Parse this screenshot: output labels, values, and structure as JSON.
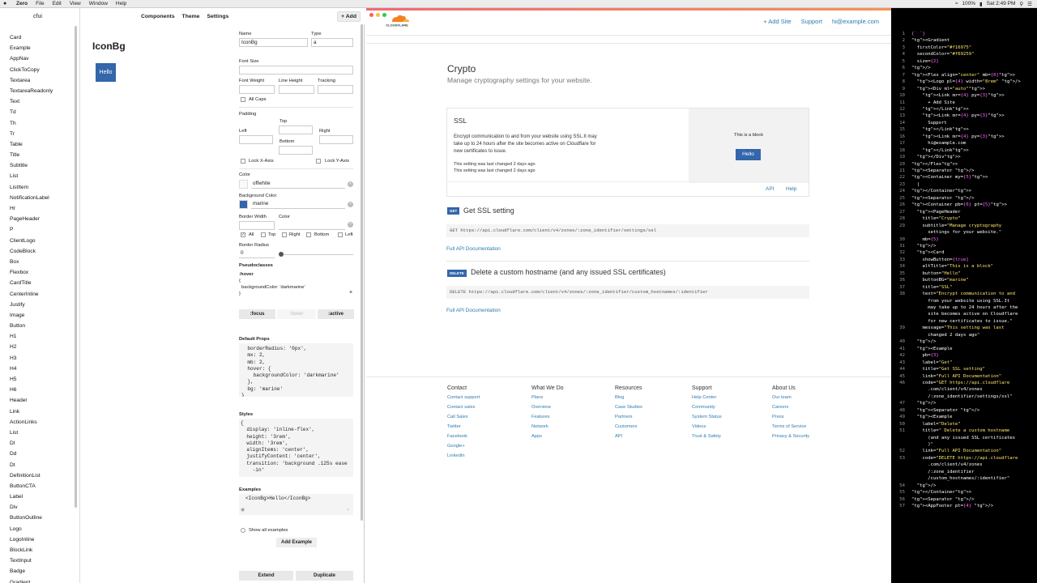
{
  "menubar": {
    "app_name": "Zero",
    "menus": [
      "File",
      "Edit",
      "View",
      "Window",
      "Help"
    ],
    "battery": "100%",
    "clock": "Sat 2:49 PM"
  },
  "sidebar": {
    "title": "cfui",
    "items": [
      "Card",
      "Example",
      "AppNav",
      "ClickToCopy",
      "Textarea",
      "TextareaReadonly",
      "Text",
      "Td",
      "Th",
      "Tr",
      "Table",
      "Title",
      "Subtitle",
      "List",
      "ListItem",
      "NotificationLabel",
      "Hr",
      "PageHeader",
      "P",
      "ClientLogo",
      "CodeBlock",
      "Box",
      "Flexbox",
      "CardTitle",
      "CenterInline",
      "Justify",
      "Image",
      "Button",
      "H1",
      "H2",
      "H3",
      "H4",
      "H5",
      "H6",
      "Header",
      "Link",
      "ActionLinks",
      "List",
      "Dl",
      "Dd",
      "Dt",
      "DefinitionList",
      "ButtonCTA",
      "Label",
      "Div",
      "ButtonOutline",
      "Logo",
      "LogoInline",
      "BlockLink",
      "TextInput",
      "Badge",
      "Gradient"
    ]
  },
  "topnav": {
    "components": "Components",
    "theme": "Theme",
    "settings": "Settings",
    "add": "+ Add"
  },
  "preview": {
    "component_name": "IconBg",
    "button_label": "Hello"
  },
  "props": {
    "name_label": "Name",
    "name_value": "IconBg",
    "type_label": "Type",
    "type_value": "a",
    "font_size_label": "Font Size",
    "font_weight_label": "Font Weight",
    "line_height_label": "Line Height",
    "tracking_label": "Tracking",
    "all_caps_label": "All Caps",
    "padding_label": "Padding",
    "top_label": "Top",
    "left_label": "Left",
    "right_label": "Right",
    "bottom_label": "Bottom",
    "lock_x_label": "Lock X-Axis",
    "lock_y_label": "Lock Y-Axis",
    "color_label": "Color",
    "color_value": "offwhite",
    "bg_color_label": "Background Color",
    "bg_color_value": "marine",
    "bg_swatch": "#3366aa",
    "border_width_label": "Border Width",
    "border_color_label": "Color",
    "border_sides": [
      "All",
      "Top",
      "Right",
      "Bottom",
      "Left"
    ],
    "border_radius_label": "Border Radius",
    "border_radius_value": "0",
    "pseudoclasses_label": "Pseudoclasses",
    "pseudo_selector": ":hover",
    "pseudo_open": "{",
    "pseudo_body": "  backgroundColor: 'darkmarine'",
    "pseudo_close": "}",
    "focus_btn": ":focus",
    "hover_btn": ":hover",
    "active_btn": ":active",
    "default_props_label": "Default Props",
    "default_props_code": "  borderRadius: '0px',\n  mx: 2,\n  mb: 2,\n  hover: {\n    backgroundColor: 'darkmarine'\n  },\n  bg: 'marine'\n}",
    "styles_label": "Styles",
    "styles_code": "{\n  display: 'inline-flex',\n  height: '3rem',\n  width: '3rem',\n  alignItems: 'center',\n  justifyContent: 'center',\n  transition: 'background .125s ease\n    -in'",
    "examples_label": "Examples",
    "example_code": "<IconBg>Hello</IconBg>",
    "show_all_examples": "Show all examples",
    "add_example": "Add Example",
    "extend": "Extend",
    "duplicate": "Duplicate"
  },
  "site": {
    "nav": [
      "+ Add Site",
      "Support",
      "hi@example.com"
    ],
    "page_title": "Crypto",
    "page_subtitle": "Manage cryptography settings for your website.",
    "card": {
      "title": "SSL",
      "text": "Encrypt communication to and from your website using SSL.It may take up to 24 hours after the site becomes active on Cloudflare for new certificates to issue.",
      "message_1": "This setting was last changed 2 days ago",
      "message_2": "This setting was last changed 2 days ago",
      "alt_title": "This is a block",
      "button": "Hello",
      "footer_links": [
        "API",
        "Help"
      ]
    },
    "example1": {
      "label": "GET",
      "title": "Get SSL setting",
      "code": "GET https://api.cloudflare.com/client/v4/zones/:zone_identifier/settings/ssl",
      "link": "Full API Documentation"
    },
    "example2": {
      "label": "DELETE",
      "title": "Delete a custom hostname (and any issued SSL certificates)",
      "code": "DELETE https://api.cloudflare.com/client/v4/zones/:zone_identifier/custom_hostnames/:identifier",
      "link": "Full API Documentation"
    },
    "footer": [
      {
        "heading": "Contact",
        "links": [
          "Contact support",
          "Contact sales",
          "Call Sales",
          "Twitter",
          "Facebook",
          "Google+",
          "LinkedIn"
        ]
      },
      {
        "heading": "What We Do",
        "links": [
          "Plans",
          "Overview",
          "Features",
          "Network",
          "Apps"
        ]
      },
      {
        "heading": "Resources",
        "links": [
          "Blog",
          "Case Studies",
          "Partners",
          "Customers",
          "API"
        ]
      },
      {
        "heading": "Support",
        "links": [
          "Help Center",
          "Community",
          "System Status",
          "Videos",
          "Trust & Safety"
        ]
      },
      {
        "heading": "About Us",
        "links": [
          "Our team",
          "Careers",
          "Press",
          "Terms of Service",
          "Privacy & Security"
        ]
      }
    ]
  },
  "editor": {
    "lines": [
      {
        "n": "1",
        "t": "{` `}"
      },
      {
        "n": "2",
        "t": "<Gradient"
      },
      {
        "n": "3",
        "t": "  firstColor=\"#f16975\""
      },
      {
        "n": "4",
        "t": "  secondColor=\"#f69259\""
      },
      {
        "n": "5",
        "t": "  size={2}"
      },
      {
        "n": "6",
        "t": "/>"
      },
      {
        "n": "7",
        "t": "<Flex align=\"center\" mb={0}>"
      },
      {
        "n": "8",
        "t": "  <Logo pl={4} width=\"8rem\" />"
      },
      {
        "n": "9",
        "t": "  <Div ml=\"auto\">"
      },
      {
        "n": "10",
        "t": "    <Link mr={4} py={3}>"
      },
      {
        "n": "11",
        "t": "      + Add Site"
      },
      {
        "n": "12",
        "t": "    </Link>"
      },
      {
        "n": "13",
        "t": "    <Link mr={4} py={3}>"
      },
      {
        "n": "14",
        "t": "      Support"
      },
      {
        "n": "15",
        "t": "    </Link>"
      },
      {
        "n": "16",
        "t": "    <Link mr={4} py={3}>"
      },
      {
        "n": "17",
        "t": "      hi@example.com"
      },
      {
        "n": "18",
        "t": "    </Link>"
      },
      {
        "n": "19",
        "t": "  </Div>"
      },
      {
        "n": "20",
        "t": "</Flex>"
      },
      {
        "n": "21",
        "t": "<Separator />"
      },
      {
        "n": "22",
        "t": "<Container my={5}>"
      },
      {
        "n": "23",
        "t": "  |"
      },
      {
        "n": "24",
        "t": "</Container>"
      },
      {
        "n": "25",
        "t": "<Separator />"
      },
      {
        "n": "26",
        "t": "<Container pb={6} pt={5}>"
      },
      {
        "n": "27",
        "t": "  <PageHeader"
      },
      {
        "n": "28",
        "t": "    title=\"Crypto\""
      },
      {
        "n": "29",
        "t": "    subtitle=\"Manage cryptography"
      },
      {
        "n": "",
        "t": "      settings for your website.\""
      },
      {
        "n": "30",
        "t": "    mb={5}"
      },
      {
        "n": "31",
        "t": "  />"
      },
      {
        "n": "32",
        "t": "  <Card"
      },
      {
        "n": "33",
        "t": "    showButton={true}"
      },
      {
        "n": "34",
        "t": "    altTitle=\"This is a block\""
      },
      {
        "n": "35",
        "t": "    button=\"Hello\""
      },
      {
        "n": "36",
        "t": "    buttonBG=\"marine\""
      },
      {
        "n": "37",
        "t": "    title=\"SSL\""
      },
      {
        "n": "38",
        "t": "    text=\"Encrypt communication to and"
      },
      {
        "n": "",
        "t": "      from your website using SSL.It"
      },
      {
        "n": "",
        "t": "      may take up to 24 hours after the"
      },
      {
        "n": "",
        "t": "      site becomes active on Cloudflare"
      },
      {
        "n": "",
        "t": "      for new certificates to issue.\""
      },
      {
        "n": "39",
        "t": "    message=\"This setting was last"
      },
      {
        "n": "",
        "t": "      changed 2 days ago\""
      },
      {
        "n": "40",
        "t": "  />"
      },
      {
        "n": "41",
        "t": "  <Example"
      },
      {
        "n": "42",
        "t": "    pb={3}"
      },
      {
        "n": "43",
        "t": "    label=\"Get\""
      },
      {
        "n": "44",
        "t": "    title=\"Get SSL setting\""
      },
      {
        "n": "45",
        "t": "    link=\"Full API Documentation\""
      },
      {
        "n": "46",
        "t": "    code=\"GET https://api.cloudflare"
      },
      {
        "n": "",
        "t": "      .com/client/v4/zones"
      },
      {
        "n": "",
        "t": "      /:zone_identifier/settings/ssl\""
      },
      {
        "n": "47",
        "t": "  />"
      },
      {
        "n": "48",
        "t": "  <Separator />"
      },
      {
        "n": "49",
        "t": "  <Example"
      },
      {
        "n": "50",
        "t": "    label=\"Delete\""
      },
      {
        "n": "51",
        "t": "    title=\" Delete a custom hostname"
      },
      {
        "n": "",
        "t": "      (and any issued SSL certificates"
      },
      {
        "n": "",
        "t": "      )\""
      },
      {
        "n": "52",
        "t": "    link=\"Full API Documentation\""
      },
      {
        "n": "53",
        "t": "    code=\"DELETE https://api.cloudflare"
      },
      {
        "n": "",
        "t": "      .com/client/v4/zones"
      },
      {
        "n": "",
        "t": "      /:zone_identifier"
      },
      {
        "n": "",
        "t": "      /custom_hostnames/:identifier\""
      },
      {
        "n": "54",
        "t": "  />"
      },
      {
        "n": "55",
        "t": "</Container>"
      },
      {
        "n": "56",
        "t": "<Separator />"
      },
      {
        "n": "57",
        "t": "<AppFooter pt={4} />"
      }
    ]
  }
}
